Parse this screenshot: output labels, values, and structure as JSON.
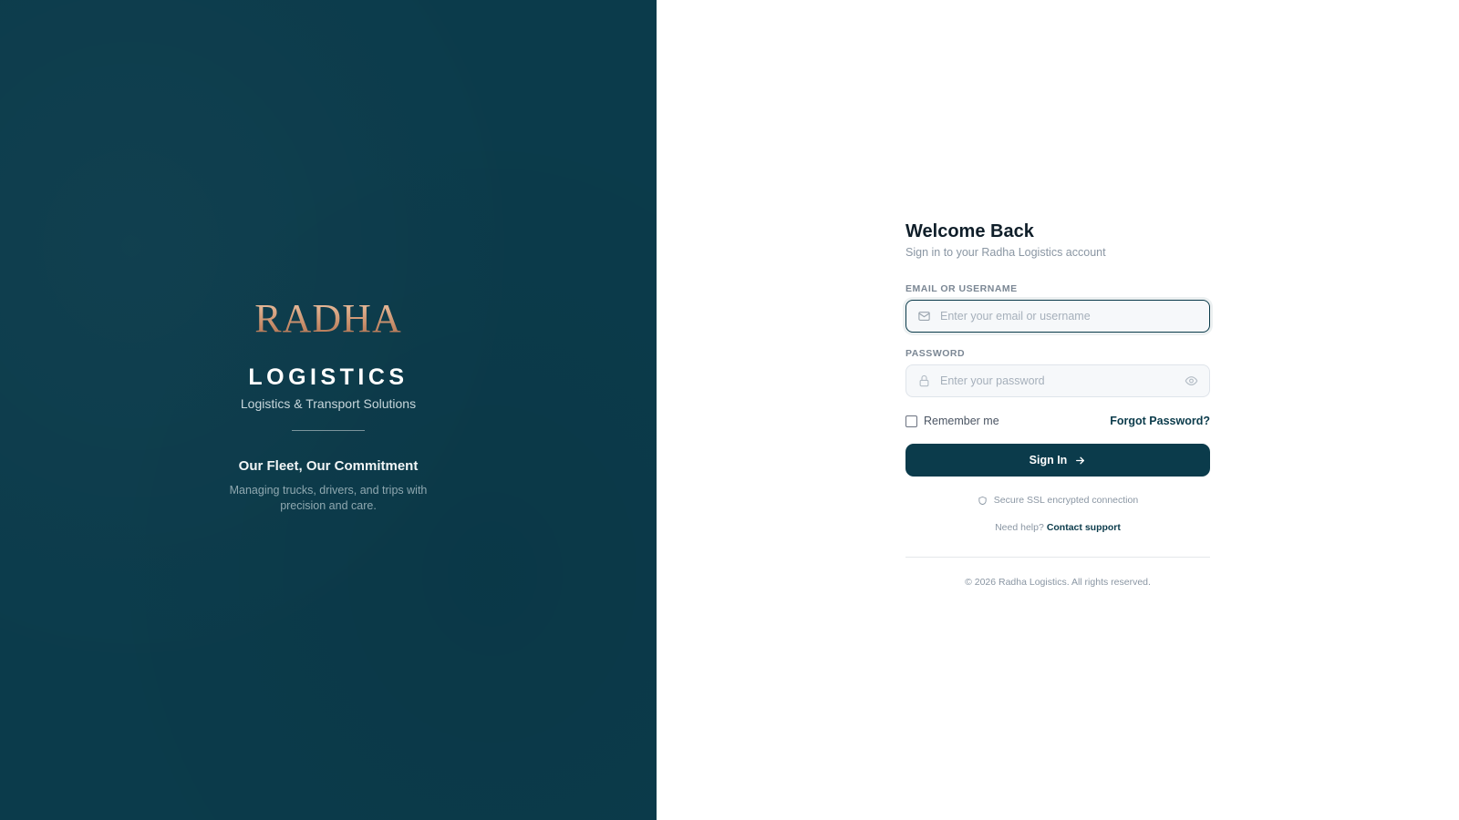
{
  "brand": {
    "logo_text": "RADHA",
    "wordmark": "LOGISTICS",
    "tagline": "Logistics & Transport Solutions",
    "commitment_title": "Our Fleet, Our Commitment",
    "commitment_desc": "Managing trucks, drivers, and trips with precision and care."
  },
  "login": {
    "title": "Welcome Back",
    "subtitle": "Sign in to your Radha Logistics account",
    "email_label": "EMAIL OR USERNAME",
    "email_placeholder": "Enter your email or username",
    "password_label": "PASSWORD",
    "password_placeholder": "Enter your password",
    "remember_label": "Remember me",
    "forgot_label": "Forgot Password?",
    "signin_label": "Sign In",
    "secure_text": "Secure SSL encrypted connection",
    "help_text": "Need help?",
    "help_link": "Contact support",
    "copyright": "© 2026 Radha Logistics. All rights reserved."
  },
  "icons": {
    "email": "mail-icon",
    "password": "lock-icon",
    "toggle": "eye-icon",
    "signin": "arrow-right-icon",
    "secure": "shield-icon"
  },
  "colors": {
    "brand_dark": "#0b3b4b",
    "logo_gold": "#d8a88a",
    "muted_text": "#8a96a3"
  }
}
